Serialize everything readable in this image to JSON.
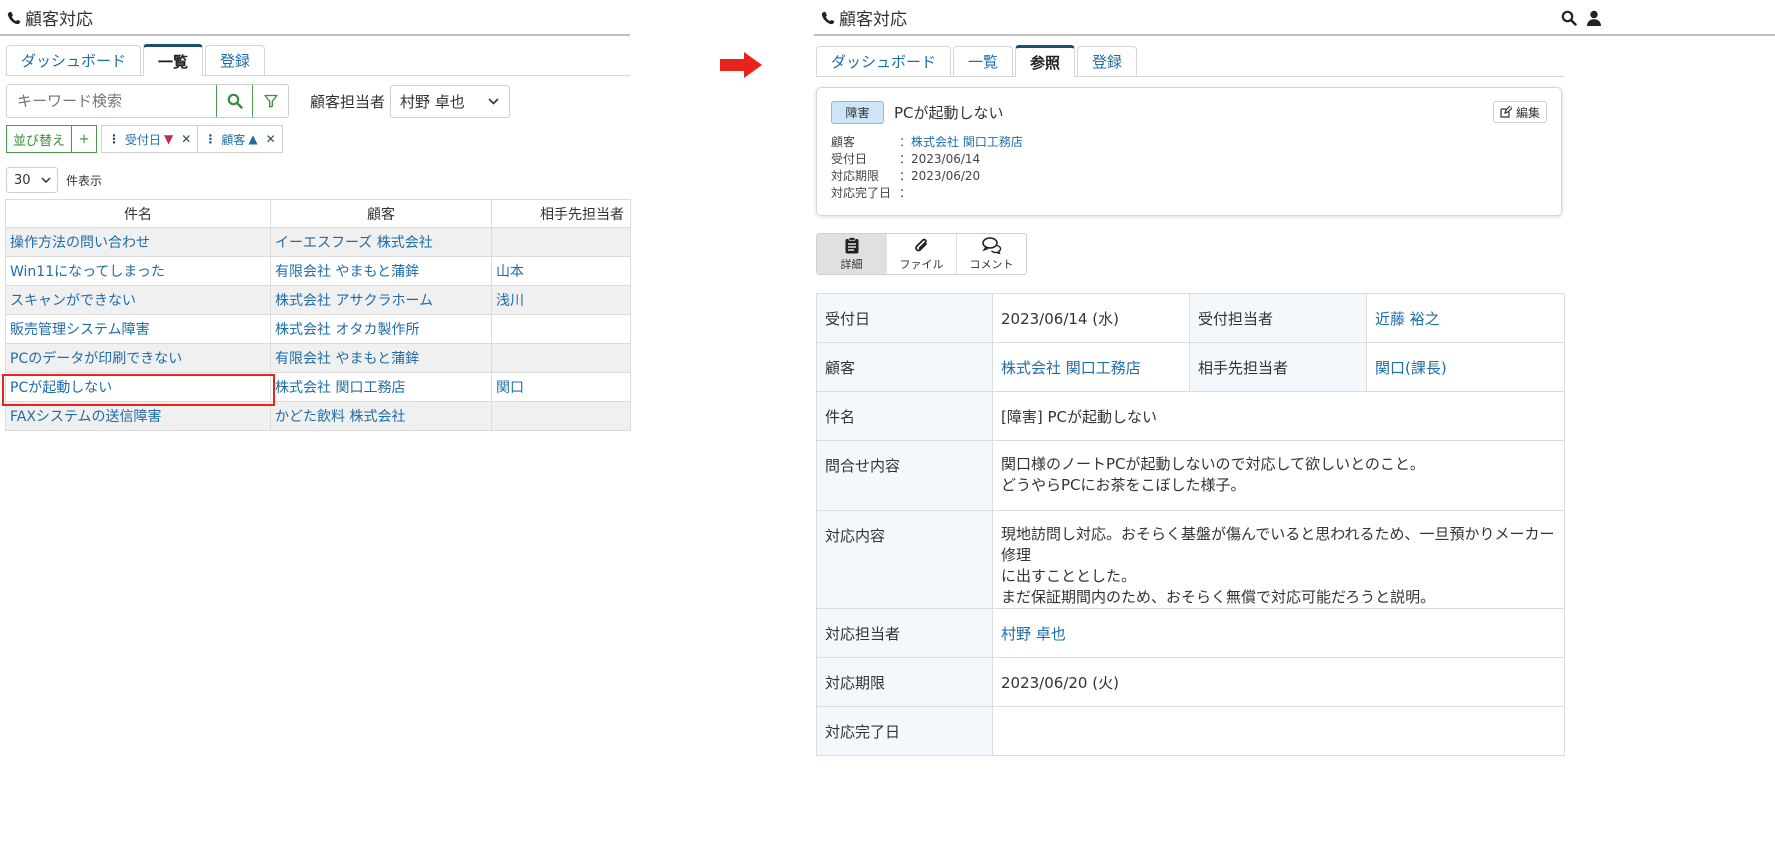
{
  "left": {
    "app_title": "顧客対応",
    "tabs": [
      {
        "label": "ダッシュボード",
        "active": false
      },
      {
        "label": "一覧",
        "active": true
      },
      {
        "label": "登録",
        "active": false
      }
    ],
    "search_placeholder": "キーワード検索",
    "assignee_label": "顧客担当者",
    "assignee_value": "村野 卓也",
    "sort_button": "並び替え",
    "sort_add": "+",
    "sort_chips": [
      {
        "label": "受付日",
        "dir": "▼"
      },
      {
        "label": "顧客",
        "dir": "▲"
      }
    ],
    "per_page_value": "30",
    "per_page_label": "件表示",
    "table": {
      "headers": [
        "件名",
        "顧客",
        "相手先担当者"
      ],
      "rows": [
        [
          "操作方法の問い合わせ",
          "イーエスフーズ 株式会社",
          ""
        ],
        [
          "Win11になってしまった",
          "有限会社 やまもと蒲鉾",
          "山本"
        ],
        [
          "スキャンができない",
          "株式会社 アサクラホーム",
          "浅川"
        ],
        [
          "販売管理システム障害",
          "株式会社 オタカ製作所",
          ""
        ],
        [
          "PCのデータが印刷できない",
          "有限会社 やまもと蒲鉾",
          ""
        ],
        [
          "PCが起動しない",
          "株式会社 関口工務店",
          "関口"
        ],
        [
          "FAXシステムの送信障害",
          "かどた飲料 株式会社",
          ""
        ]
      ]
    }
  },
  "right": {
    "app_title": "顧客対応",
    "tabs": [
      {
        "label": "ダッシュボード",
        "active": false
      },
      {
        "label": "一覧",
        "active": false
      },
      {
        "label": "参照",
        "active": true
      },
      {
        "label": "登録",
        "active": false
      }
    ],
    "card": {
      "badge": "障害",
      "title": "PCが起動しない",
      "edit": "編集",
      "meta": [
        {
          "key": "顧客",
          "value": "：株式会社 関口工務店",
          "link": true
        },
        {
          "key": "受付日",
          "value": "：2023/06/14",
          "link": false
        },
        {
          "key": "対応期限",
          "value": "：2023/06/20",
          "link": false
        },
        {
          "key": "対応完了日",
          "value": "：",
          "link": false
        }
      ]
    },
    "segments": [
      {
        "label": "詳細",
        "icon": "clipboard-icon",
        "active": true
      },
      {
        "label": "ファイル",
        "icon": "paperclip-icon",
        "active": false
      },
      {
        "label": "コメント",
        "icon": "comments-icon",
        "active": false
      }
    ],
    "detail": {
      "recv_date_label": "受付日",
      "recv_date": "2023/06/14 (水)",
      "recv_staff_label": "受付担当者",
      "recv_staff": "近藤 裕之",
      "customer_label": "顧客",
      "customer": "株式会社 関口工務店",
      "contact_label": "相手先担当者",
      "contact": "関口(課長)",
      "subject_label": "件名",
      "subject": "[障害] PCが起動しない",
      "inquiry_label": "問合せ内容",
      "inquiry_1": "関口様のノートPCが起動しないので対応して欲しいとのこと。",
      "inquiry_2": "どうやらPCにお茶をこぼした様子。",
      "response_label": "対応内容",
      "response_1": "現地訪問し対応。おそらく基盤が傷んでいると思われるため、一旦預かりメーカー修理",
      "response_2": "に出すこととした。",
      "response_3": "まだ保証期間内のため、おそらく無償で対応可能だろうと説明。",
      "handler_label": "対応担当者",
      "handler": "村野 卓也",
      "deadline_label": "対応期限",
      "deadline": "2023/06/20 (火)",
      "done_label": "対応完了日",
      "done": ""
    }
  },
  "colors": {
    "link": "#1f6da8",
    "accent_green": "#3a8d3a",
    "highlight_red": "#e8231e",
    "arrow_red": "#e8231e"
  }
}
